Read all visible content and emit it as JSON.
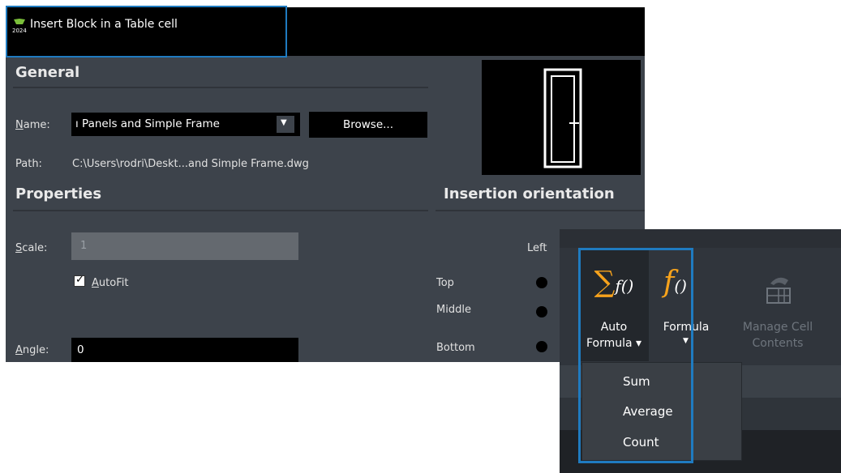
{
  "dialog": {
    "title": "Insert Block in a Table cell",
    "app_badge": "2024",
    "general": {
      "heading": "General",
      "name_label": "Name:",
      "name_value": "ı Panels and Simple Frame",
      "browse_label": "Browse...",
      "path_label": "Path:",
      "path_value": "C:\\Users\\rodri\\Deskt...and Simple Frame.dwg"
    },
    "properties": {
      "heading": "Properties",
      "scale_label": "Scale:",
      "scale_value": "1",
      "autofit_label": "AutoFit",
      "autofit_checked": true,
      "angle_label": "Angle:",
      "angle_value": "0"
    },
    "insertion": {
      "heading": "Insertion orientation",
      "left_label": "Left",
      "rows": [
        "Top",
        "Middle",
        "Bottom"
      ]
    }
  },
  "ribbon": {
    "auto_formula": {
      "symbol": "∑",
      "sub": "f()",
      "line1": "Auto",
      "line2": "Formula ▾"
    },
    "formula": {
      "symbol": "f",
      "sub": "()",
      "line1": "Formula",
      "dropdown": "▼"
    },
    "manage": {
      "line1": "Manage Cell",
      "line2": "Contents"
    },
    "menu": [
      "Sum",
      "Average",
      "Count"
    ]
  },
  "colors": {
    "dialog_bg": "#3d434b",
    "titlebar_bg": "#000000",
    "highlight": "#1f7bc0",
    "accent_orange": "#f7a31c"
  }
}
